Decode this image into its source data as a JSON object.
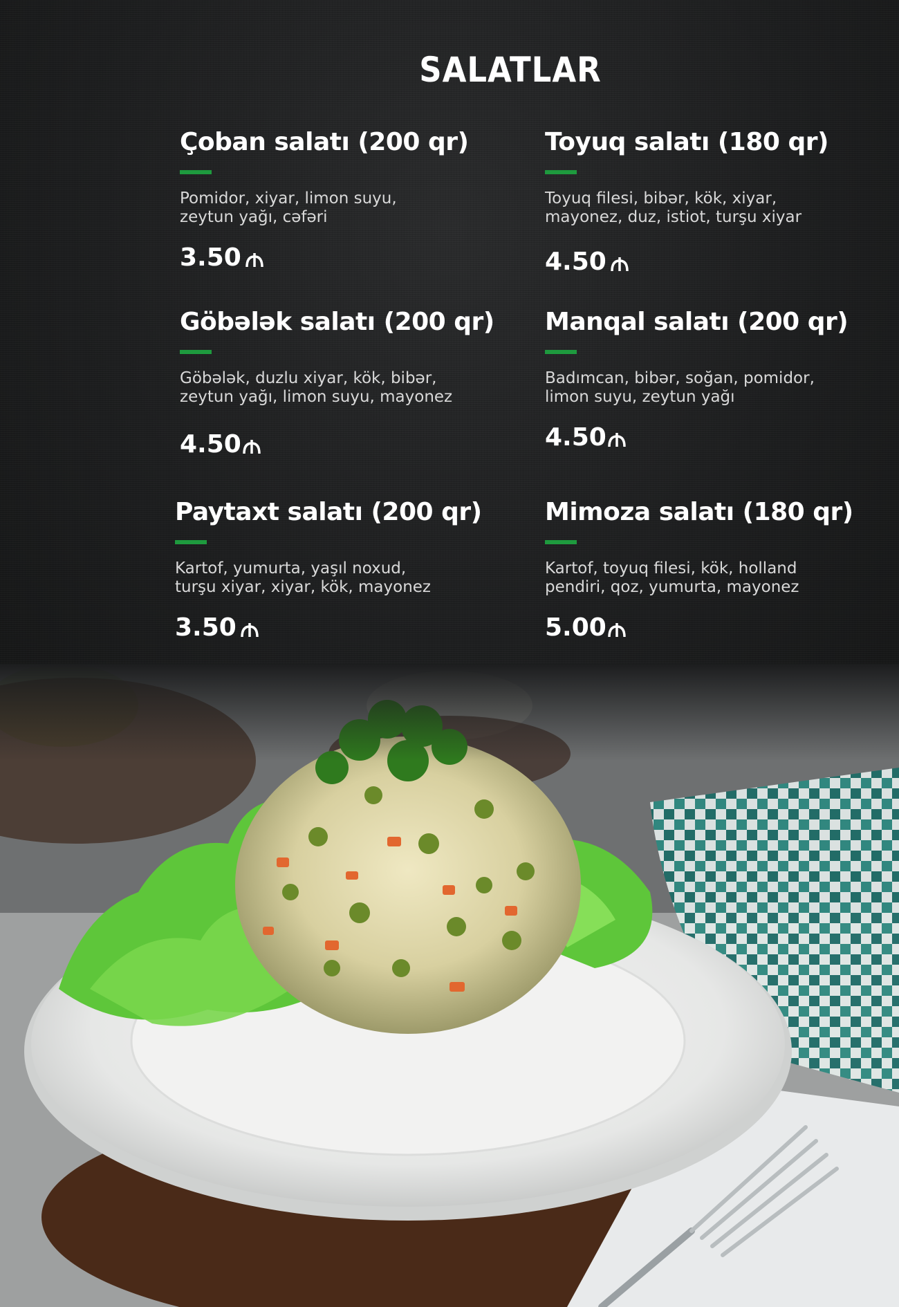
{
  "menu": {
    "title": "SALATLAR",
    "items": [
      {
        "name": "Çoban salatı (200 qr)",
        "description": "Pomidor, xiyar, limon suyu,\nzeytun yağı, cəfəri",
        "price": "3.50"
      },
      {
        "name": "Toyuq salatı (180 qr)",
        "description": "Toyuq filesi, bibər, kök, xiyar,\nmayonez, duz, istiot, turşu xiyar",
        "price": "4.50"
      },
      {
        "name": "Göbələk salatı (200 qr)",
        "description": "Göbələk, duzlu xiyar, kök, bibər,\nzeytun yağı, limon suyu, mayonez",
        "price": "4.50"
      },
      {
        "name": "Manqal salatı (200 qr)",
        "description": "Badımcan, bibər, soğan, pomidor,\nlimon suyu, zeytun yağı",
        "price": "4.50"
      },
      {
        "name": "Paytaxt salatı (200 qr)",
        "description": "Kartof, yumurta, yaşıl noxud,\nturşu xiyar, xiyar, kök, mayonez",
        "price": "3.50"
      },
      {
        "name": "Mimoza salatı (180 qr)",
        "description": "Kartof, toyuq filesi, kök, holland\npendiri, qoz, yumurta, mayonez",
        "price": "5.00"
      }
    ],
    "currency_icon": "manat-icon",
    "accent_color": "#1e9a3e"
  }
}
